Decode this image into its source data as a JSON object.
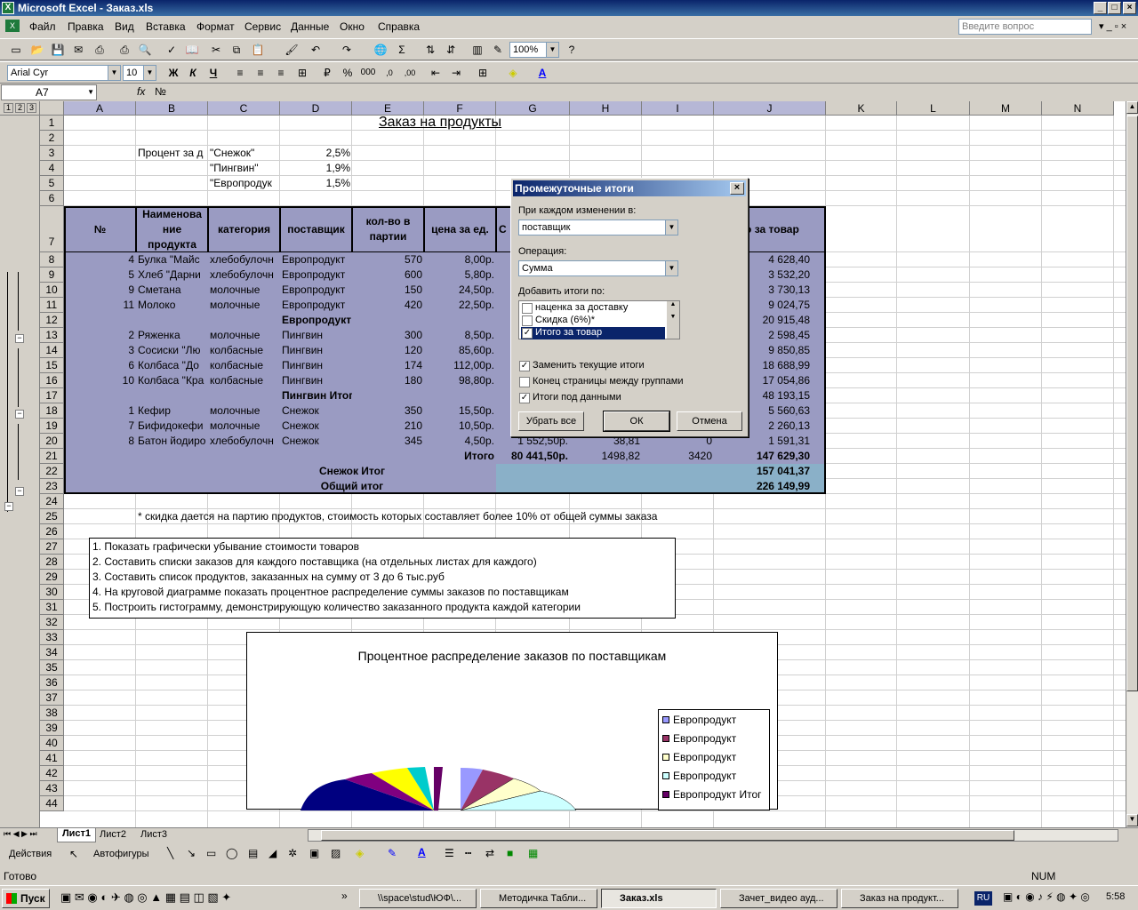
{
  "window": {
    "title": "Microsoft Excel - Заказ.xls"
  },
  "menu": [
    "Файл",
    "Правка",
    "Вид",
    "Вставка",
    "Формат",
    "Сервис",
    "Данные",
    "Окно",
    "Справка"
  ],
  "help_placeholder": "Введите вопрос",
  "toolbar": {
    "zoom": "100%",
    "font": "Arial Cyr",
    "size": "10",
    "bold": "Ж",
    "italic": "К",
    "underline": "Ч"
  },
  "formula": {
    "cell": "A7",
    "fx": "fx",
    "value": "№"
  },
  "columns": [
    "A",
    "B",
    "C",
    "D",
    "E",
    "F",
    "G",
    "H",
    "I",
    "J",
    "K",
    "L",
    "M",
    "N"
  ],
  "rows": [
    "1",
    "2",
    "3",
    "4",
    "5",
    "6",
    "7",
    "8",
    "9",
    "10",
    "11",
    "12",
    "13",
    "14",
    "15",
    "16",
    "17",
    "18",
    "19",
    "20",
    "21",
    "22",
    "23",
    "24",
    "25",
    "26",
    "27",
    "28",
    "29",
    "30",
    "31",
    "32",
    "33",
    "34",
    "35",
    "36",
    "37",
    "38",
    "39",
    "40",
    "41",
    "42",
    "43",
    "44"
  ],
  "sheet": {
    "title": "Заказ на продукты",
    "discount_label": "Процент за д",
    "suppliers": [
      {
        "name": "\"Снежок\"",
        "pct": "2,5%"
      },
      {
        "name": "\"Пингвин\"",
        "pct": "1,9%"
      },
      {
        "name": "\"Европродук",
        "pct": "1,5%"
      }
    ],
    "headers": {
      "num": "№",
      "name": "Наименова ние продукта",
      "cat": "категория",
      "sup": "поставщик",
      "qty": "кол-во в партии",
      "price": "цена за ед.",
      "g": "С",
      "total": "го за товар"
    },
    "data": [
      {
        "a": "4",
        "b": "Булка \"Майс",
        "c": "хлебобулочн",
        "d": "Европродукт",
        "e": "570",
        "f": "8,00р.",
        "j": "4 628,40"
      },
      {
        "a": "5",
        "b": "Хлеб \"Дарни",
        "c": "хлебобулочн",
        "d": "Европродукт",
        "e": "600",
        "f": "5,80р.",
        "j": "3 532,20"
      },
      {
        "a": "9",
        "b": "Сметана",
        "c": "молочные",
        "d": "Европродукт",
        "e": "150",
        "f": "24,50р.",
        "j": "3 730,13"
      },
      {
        "a": "11",
        "b": "Молоко",
        "c": "молочные",
        "d": "Европродукт",
        "e": "420",
        "f": "22,50р.",
        "j": "9 024,75"
      },
      {
        "a": "",
        "b": "",
        "c": "",
        "d": "Европродукт Итог",
        "e": "",
        "f": "",
        "j": "20 915,48"
      },
      {
        "a": "2",
        "b": "Ряженка",
        "c": "молочные",
        "d": "Пингвин",
        "e": "300",
        "f": "8,50р.",
        "j": "2 598,45"
      },
      {
        "a": "3",
        "b": "Сосиски \"Лю",
        "c": "колбасные",
        "d": "Пингвин",
        "e": "120",
        "f": "85,60р.",
        "j": "9 850,85"
      },
      {
        "a": "6",
        "b": "Колбаса \"До",
        "c": "колбасные",
        "d": "Пингвин",
        "e": "174",
        "f": "112,00р.",
        "j": "18 688,99"
      },
      {
        "a": "10",
        "b": "Колбаса \"Кра",
        "c": "колбасные",
        "d": "Пингвин",
        "e": "180",
        "f": "98,80р.",
        "j": "17 054,86"
      },
      {
        "a": "",
        "b": "",
        "c": "",
        "d": "Пингвин Итог",
        "e": "",
        "f": "",
        "j": "48 193,15"
      },
      {
        "a": "1",
        "b": "Кефир",
        "c": "молочные",
        "d": "Снежок",
        "e": "350",
        "f": "15,50р.",
        "j": "5 560,63"
      },
      {
        "a": "7",
        "b": "Бифидокефи",
        "c": "молочные",
        "d": "Снежок",
        "e": "210",
        "f": "10,50р.",
        "j": "2 260,13"
      },
      {
        "a": "8",
        "b": "Батон йодиро",
        "c": "хлебобулочн",
        "d": "Снежок",
        "e": "345",
        "f": "4,50р.",
        "g": "1 552,50р.",
        "h": "38,81",
        "i": "0",
        "j": "1 591,31"
      }
    ],
    "row21": {
      "f": "Итого",
      "g": "80 441,50р.",
      "h": "1498,82",
      "i": "3420",
      "j": "147 629,30"
    },
    "row22": {
      "label": "Снежок Итог",
      "j": "157 041,37"
    },
    "row23": {
      "label": "Общий итог",
      "j": "226 149,99"
    },
    "note": "* скидка дается на партию продуктов, стоимость которых составляет более 10% от общей суммы заказа",
    "tasks": [
      "1. Показать графически убывание стоимости товаров",
      "2. Составить списки заказов для каждого поставщика (на отдельных листах для каждого)",
      "3. Составить список продуктов, заказанных на сумму от 3 до 6 тыс.руб",
      "4. На круговой диаграмме показать процентное распределение суммы заказов по поставщикам",
      "5. Построить гистограмму, демонстрирующую количество заказанного продукта каждой категории"
    ]
  },
  "chart": {
    "title": "Процентное распределение заказов по поставщикам",
    "legend": [
      {
        "name": "Европродукт",
        "color": "#9999ff"
      },
      {
        "name": "Европродукт",
        "color": "#993366"
      },
      {
        "name": "Европродукт",
        "color": "#ffffcc"
      },
      {
        "name": "Европродукт",
        "color": "#ccffff"
      },
      {
        "name": "Европродукт Итог",
        "color": "#660066"
      }
    ]
  },
  "dialog": {
    "title": "Промежуточные итоги",
    "label_change": "При каждом изменении в:",
    "change_value": "поставщик",
    "label_op": "Операция:",
    "op_value": "Сумма",
    "label_add": "Добавить итоги по:",
    "add_items": [
      {
        "label": "наценка за доставку",
        "checked": false
      },
      {
        "label": "Скидка (6%)*",
        "checked": false
      },
      {
        "label": "Итого за товар",
        "checked": true
      }
    ],
    "opt_replace": "Заменить текущие итоги",
    "opt_pagebreak": "Конец страницы между группами",
    "opt_below": "Итоги под данными",
    "btn_remove": "Убрать все",
    "btn_ok": "ОК",
    "btn_cancel": "Отмена"
  },
  "tabs": [
    "Лист1",
    "Лист2",
    "Лист3"
  ],
  "drawbar": {
    "actions": "Действия",
    "autoshapes": "Автофигуры"
  },
  "status": {
    "left": "Готово",
    "num": "NUM"
  },
  "taskbar": {
    "start": "Пуск",
    "items": [
      "\\\\space\\stud\\ЮФ\\...",
      "Методичка Табли...",
      "Заказ.xls",
      "Зачет_видео ауд...",
      "Заказ на продукт..."
    ],
    "lang": "RU",
    "clock": "5:58"
  }
}
